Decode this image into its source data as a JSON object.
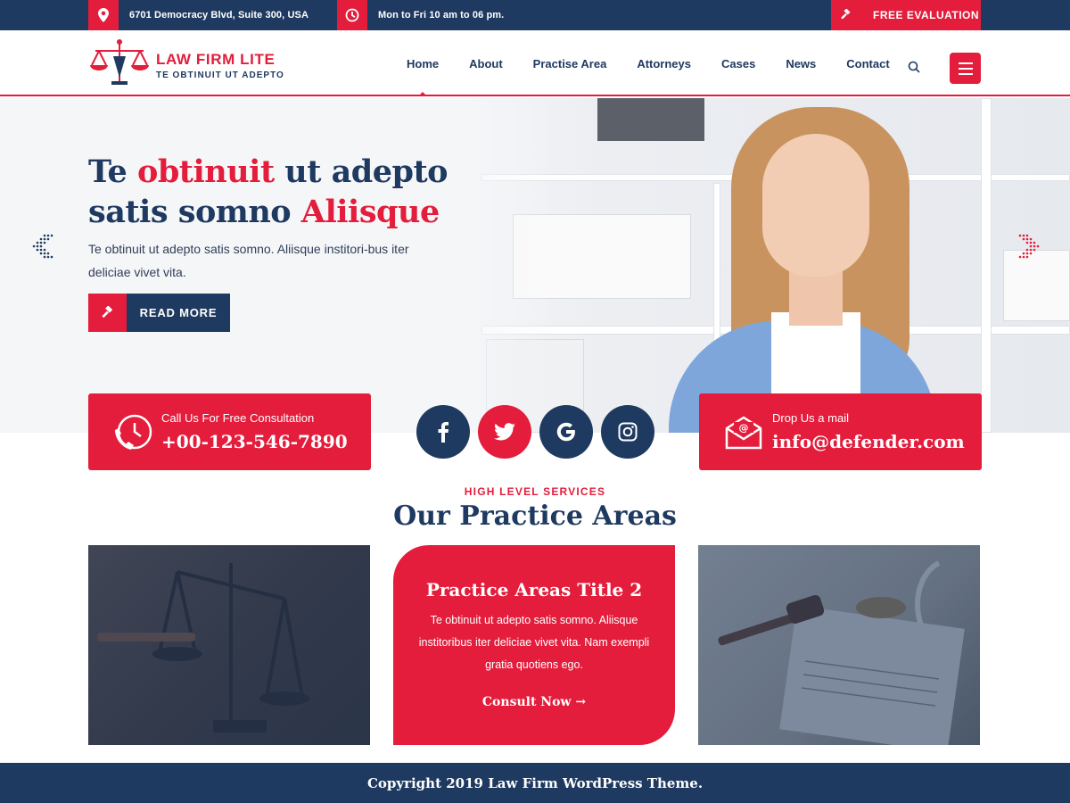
{
  "topbar": {
    "address": "6701 Democracy Blvd, Suite 300, USA",
    "hours": "Mon to Fri 10 am to 06 pm.",
    "cta": "FREE EVALUATION"
  },
  "logo": {
    "title": "LAW FIRM LITE",
    "tagline": "TE OBTINUIT UT ADEPTO"
  },
  "nav": {
    "items": [
      "Home",
      "About",
      "Practise Area",
      "Attorneys",
      "Cases",
      "News",
      "Contact"
    ],
    "active": "Home"
  },
  "hero": {
    "title_part1": "Te ",
    "title_red1": "obtinuit",
    "title_part2": " ut adepto",
    "title_part3": "satis somno ",
    "title_red2": "Aliisque",
    "text": "Te obtinuit ut adepto satis somno. Aliisque institori-bus iter deliciae vivet vita.",
    "button": "READ MORE"
  },
  "contact": {
    "phone_label": "Call Us For Free Consultation",
    "phone": "+00-123-546-7890",
    "mail_label": "Drop Us a mail",
    "mail": "info@defender.com"
  },
  "socials": [
    "facebook-icon",
    "twitter-icon",
    "google-icon",
    "instagram-icon"
  ],
  "practice": {
    "kicker": "HIGH LEVEL SERVICES",
    "title": "Our Practice Areas",
    "featured_title": "Practice Areas Title 2",
    "featured_text": "Te obtinuit ut adepto satis somno. Aliisque institoribus iter deliciae vivet vita. Nam exempli gratia quotiens ego.",
    "featured_link": "Consult Now →"
  },
  "footer": {
    "copyright": "Copyright 2019 Law Firm WordPress Theme."
  },
  "colors": {
    "navy": "#1f3a60",
    "red": "#e31d3b"
  }
}
